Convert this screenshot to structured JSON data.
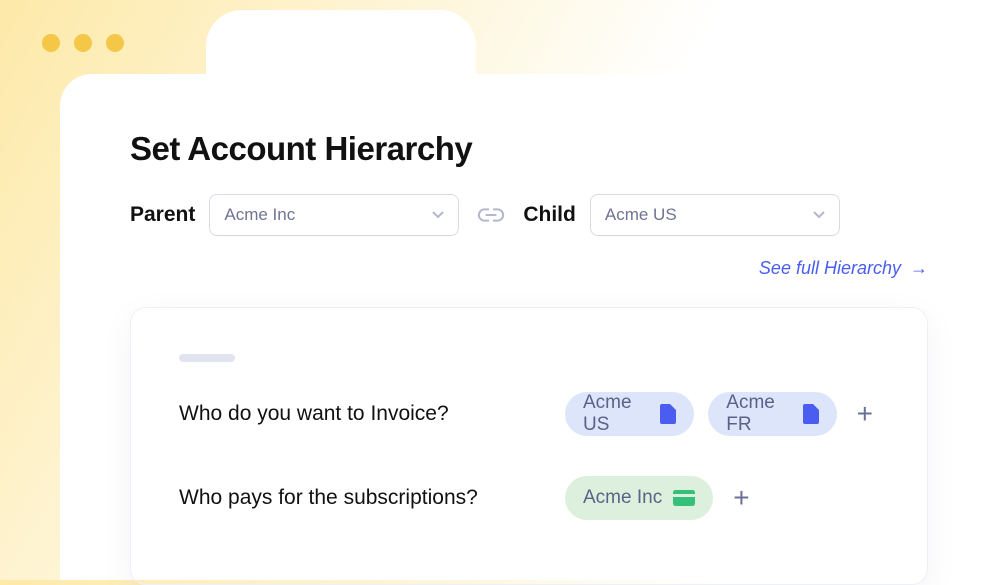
{
  "page": {
    "title": "Set Account Hierarchy"
  },
  "selectors": {
    "parent_label": "Parent",
    "parent_value": "Acme Inc",
    "child_label": "Child",
    "child_value": "Acme US"
  },
  "link": {
    "see_full": "See full Hierarchy",
    "arrow": "→"
  },
  "questions": {
    "invoice": {
      "text": "Who do you want to Invoice?",
      "chips": [
        {
          "label": "Acme US"
        },
        {
          "label": "Acme FR"
        }
      ]
    },
    "payer": {
      "text": "Who pays for the subscriptions?",
      "chips": [
        {
          "label": "Acme Inc"
        }
      ]
    }
  }
}
